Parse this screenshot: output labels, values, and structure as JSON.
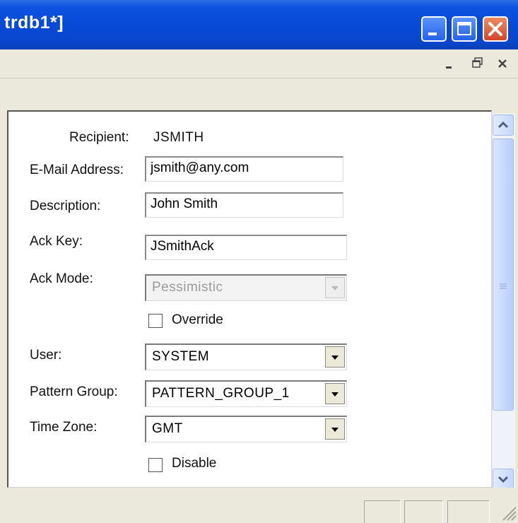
{
  "window": {
    "title": "trdb1*]"
  },
  "form": {
    "recipient_label": "Recipient:",
    "recipient_value": "JSMITH",
    "email_label": "E-Mail Address:",
    "email_value": "jsmith@any.com",
    "description_label": "Description:",
    "description_value": "John Smith",
    "ack_key_label": "Ack Key:",
    "ack_key_value": "JSmithAck",
    "ack_mode_label": "Ack Mode:",
    "ack_mode_value": "Pessimistic",
    "override_label": "Override",
    "user_label": "User:",
    "user_value": "SYSTEM",
    "pattern_group_label": "Pattern Group:",
    "pattern_group_value": "PATTERN_GROUP_1",
    "time_zone_label": "Time Zone:",
    "time_zone_value": "GMT",
    "disable_label": "Disable"
  }
}
